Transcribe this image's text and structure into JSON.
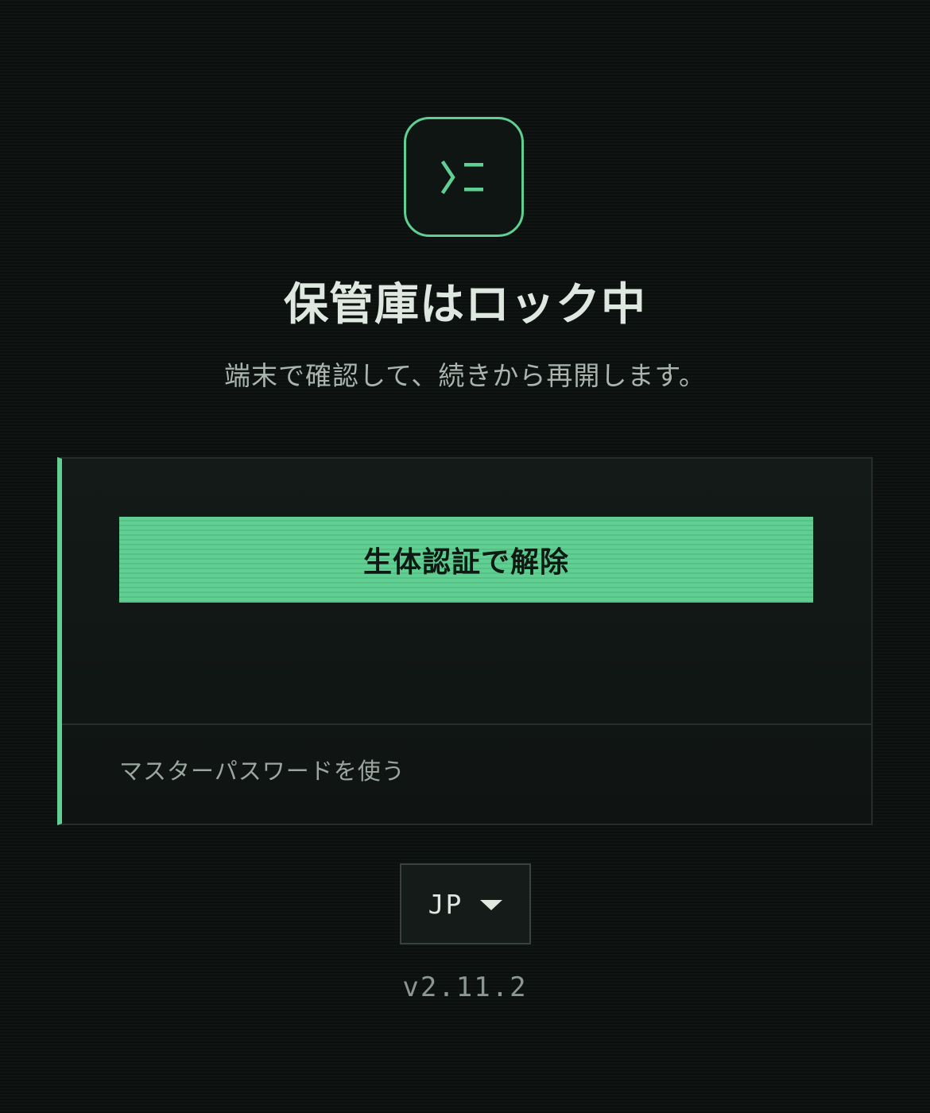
{
  "app_icon": {
    "icon": "terminal-prompt-icon",
    "accent_color": "#5fcf92"
  },
  "lock_screen": {
    "title": "保管庫はロック中",
    "subtitle": "端末で確認して、続きから再開します。"
  },
  "unlock_panel": {
    "biometric_button_label": "生体認証で解除",
    "master_password_link": "マスターパスワードを使う"
  },
  "language_selector": {
    "selected": "JP",
    "icon": "caret-down-icon"
  },
  "footer": {
    "version": "v2.11.2"
  },
  "colors": {
    "background": "#0b0f0e",
    "accent": "#5fcf92",
    "text_primary": "#dfe7e1",
    "text_secondary": "#a9b5ae"
  }
}
